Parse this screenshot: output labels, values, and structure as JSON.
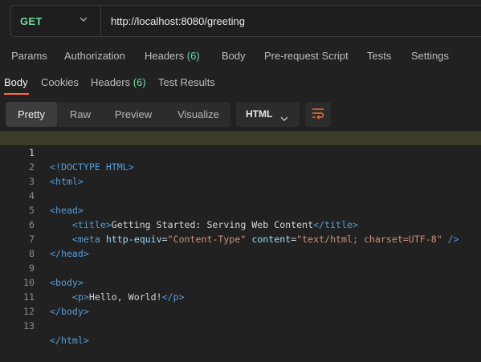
{
  "request": {
    "method": "GET",
    "url": "http://localhost:8080/greeting"
  },
  "request_tabs": [
    {
      "label": "Params"
    },
    {
      "label": "Authorization"
    },
    {
      "label": "Headers",
      "count": "(6)"
    },
    {
      "label": "Body"
    },
    {
      "label": "Pre-request Script"
    },
    {
      "label": "Tests"
    },
    {
      "label": "Settings"
    }
  ],
  "response_tabs": [
    {
      "label": "Body",
      "active": true
    },
    {
      "label": "Cookies"
    },
    {
      "label": "Headers",
      "count": "(6)"
    },
    {
      "label": "Test Results"
    }
  ],
  "view_modes": [
    "Pretty",
    "Raw",
    "Preview",
    "Visualize"
  ],
  "active_view": "Pretty",
  "format": "HTML",
  "colors": {
    "accent": "#ff6c37",
    "method": "#6bdd9a"
  },
  "icons": {
    "wrap": "wrap-lines-icon",
    "dropdown": "chevron-down-icon"
  },
  "code": {
    "highlighted_line": 1,
    "lines": [
      {
        "n": "1"
      },
      {
        "n": "2"
      },
      {
        "n": "3"
      },
      {
        "n": "4"
      },
      {
        "n": "5"
      },
      {
        "n": "6"
      },
      {
        "n": "7"
      },
      {
        "n": "8"
      },
      {
        "n": "9"
      },
      {
        "n": "10"
      },
      {
        "n": "11"
      },
      {
        "n": "12"
      },
      {
        "n": "13"
      }
    ],
    "tokens": {
      "l1": [
        "<!DOCTYPE ",
        "HTML",
        ">"
      ],
      "l2": [
        "<",
        "html",
        ">"
      ],
      "l4": [
        "<",
        "head",
        ">"
      ],
      "l5": [
        "    <",
        "title",
        ">",
        "Getting Started: Serving Web Content",
        "</",
        "title",
        ">"
      ],
      "l6": [
        "    <",
        "meta",
        " ",
        "http-equiv",
        "=",
        "\"Content-Type\"",
        " ",
        "content",
        "=",
        "\"text/html; charset=UTF-8\"",
        " />"
      ],
      "l7": [
        "</",
        "head",
        ">"
      ],
      "l9": [
        "<",
        "body",
        ">"
      ],
      "l10": [
        "    <",
        "p",
        ">",
        "Hello, World!",
        "</",
        "p",
        ">"
      ],
      "l11": [
        "</",
        "body",
        ">"
      ],
      "l13": [
        "</",
        "html",
        ">"
      ]
    }
  }
}
